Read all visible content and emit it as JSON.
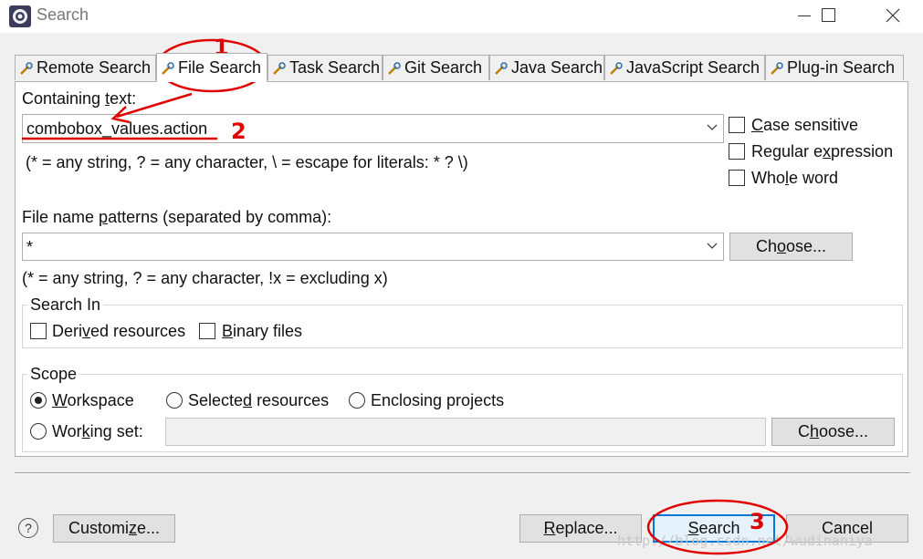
{
  "window": {
    "title": "Search"
  },
  "tabs": [
    {
      "label": "Remote Search",
      "active": false
    },
    {
      "label": "File Search",
      "active": true
    },
    {
      "label": "Task Search",
      "active": false
    },
    {
      "label": "Git Search",
      "active": false
    },
    {
      "label": "Java Search",
      "active": false
    },
    {
      "label": "JavaScript Search",
      "active": false
    },
    {
      "label": "Plug-in Search",
      "active": false
    }
  ],
  "containing": {
    "label_pre": "Containing ",
    "label_mnemonic": "t",
    "label_post": "ext:",
    "value": "combobox_values.action",
    "hint": "(* = any string, ? = any character, \\ = escape for literals: * ? \\)"
  },
  "options": {
    "case_sensitive": {
      "pre": "",
      "mn": "C",
      "post": "ase sensitive",
      "checked": false
    },
    "regex": {
      "pre": "Regular e",
      "mn": "x",
      "post": "pression",
      "checked": false
    },
    "whole_word": {
      "pre": "Who",
      "mn": "l",
      "post": "e word",
      "checked": false
    }
  },
  "patterns": {
    "label_pre": "File name ",
    "label_mnemonic": "p",
    "label_post": "atterns (separated by comma):",
    "value": "*",
    "hint": "(* = any string, ? = any character, !x = excluding x)",
    "choose_pre": "Ch",
    "choose_mn": "o",
    "choose_post": "ose..."
  },
  "search_in": {
    "title": "Search In",
    "derived": {
      "pre": "Deri",
      "mn": "v",
      "post": "ed resources",
      "checked": false
    },
    "binary": {
      "pre": "",
      "mn": "B",
      "post": "inary files",
      "checked": false
    }
  },
  "scope": {
    "title": "Scope",
    "workspace": {
      "pre": "",
      "mn": "W",
      "post": "orkspace",
      "selected": true
    },
    "selected_resources": {
      "pre": "Selecte",
      "mn": "d",
      "post": " resources",
      "selected": false
    },
    "enclosing_projects": {
      "pre": "Enclosing projects",
      "mn": "",
      "post": "",
      "selected": false
    },
    "working_set": {
      "pre": "Wor",
      "mn": "k",
      "post": "ing set:",
      "selected": false,
      "value": ""
    },
    "choose_pre": "C",
    "choose_mn": "h",
    "choose_post": "oose..."
  },
  "footer": {
    "help_glyph": "?",
    "customize_pre": "Customi",
    "customize_mn": "z",
    "customize_post": "e...",
    "replace_pre": "",
    "replace_mn": "R",
    "replace_post": "eplace...",
    "search_pre": "",
    "search_mn": "S",
    "search_post": "earch",
    "cancel": "Cancel"
  },
  "annotations": {
    "n1": "1",
    "n2": "2",
    "n3": "3",
    "color": "#e00000"
  },
  "watermark": "http://blog.csdn.net/wudinaniya",
  "colors": {
    "focus_blue": "#0078d7",
    "panel_border": "#b0b0b0"
  }
}
